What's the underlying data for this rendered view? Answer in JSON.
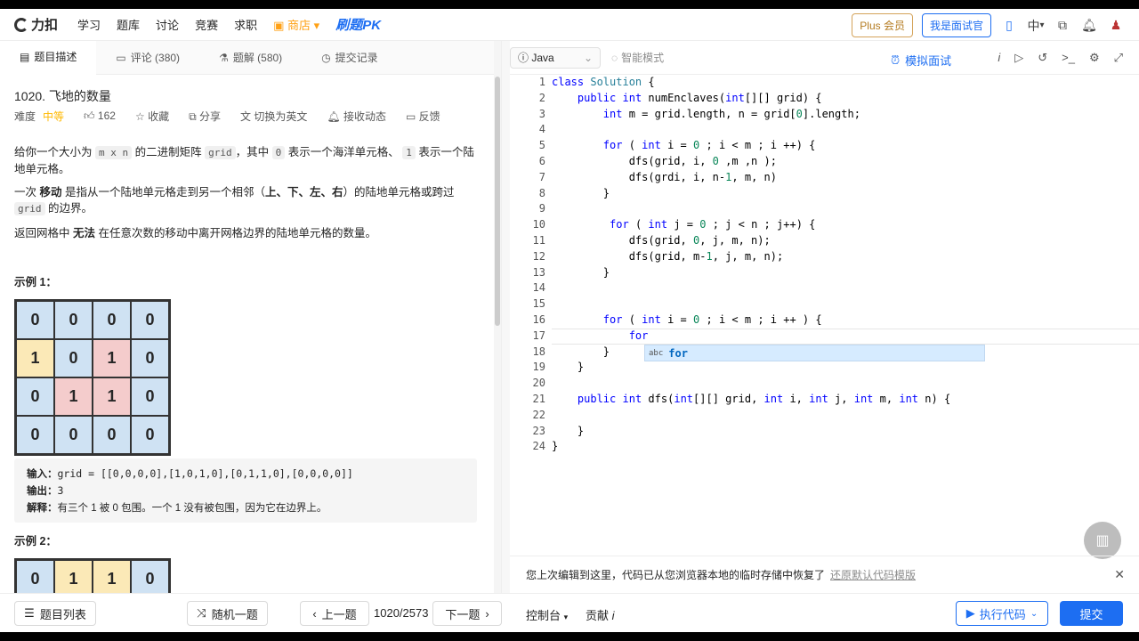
{
  "topbar": {
    "logo_text": "力扣",
    "nav": [
      "学习",
      "题库",
      "讨论",
      "竞赛",
      "求职"
    ],
    "store": "商店",
    "pk": "刷题PK",
    "plus": "Plus 会员",
    "interviewer": "我是面试官",
    "lang": "中"
  },
  "left_tabs": [
    "题目描述",
    "评论 (380)",
    "题解 (580)",
    "提交记录"
  ],
  "problem": {
    "title": "1020. 飞地的数量",
    "difficulty_label": "难度",
    "difficulty": "中等",
    "likes": "162",
    "favorite": "收藏",
    "share": "分享",
    "switch_en": "切换为英文",
    "subscribe": "接收动态",
    "feedback": "反馈",
    "desc1_a": "给你一个大小为",
    "desc1_code1": "m x n",
    "desc1_b": "的二进制矩阵",
    "desc1_code2": "grid",
    "desc1_c": "，其中",
    "desc1_code3": "0",
    "desc1_d": "表示一个海洋单元格、",
    "desc1_code4": "1",
    "desc1_e": "表示一个陆地单元格。",
    "desc2_a": "一次",
    "desc2_bold1": "移动",
    "desc2_b": "是指从一个陆地单元格走到另一个相邻（",
    "desc2_bold2": "上、下、左、右",
    "desc2_c": "）的陆地单元格或跨过",
    "desc2_code": "grid",
    "desc2_d": "的边界。",
    "desc3_a": "返回网格中",
    "desc3_bold": "无法",
    "desc3_b": "在任意次数的移动中离开网格边界的陆地单元格的数量。",
    "example1_title": "示例 1：",
    "example1_grid": [
      [
        "0",
        "0",
        "0",
        "0"
      ],
      [
        "1",
        "0",
        "1",
        "0"
      ],
      [
        "0",
        "1",
        "1",
        "0"
      ],
      [
        "0",
        "0",
        "0",
        "0"
      ]
    ],
    "example1_input_label": "输入：",
    "example1_input": "grid = [[0,0,0,0],[1,0,1,0],[0,1,1,0],[0,0,0,0]]",
    "example1_output_label": "输出：",
    "example1_output": "3",
    "example1_explain_label": "解释：",
    "example1_explain": "有三个 1 被 0 包围。一个 1 没有被包围，因为它在边界上。",
    "example2_title": "示例 2：",
    "example2_grid_row": [
      "0",
      "1",
      "1",
      "0"
    ]
  },
  "editor": {
    "language": "Java",
    "smart_mode": "智能模式",
    "mock_interview": "模拟面试",
    "line_numbers": [
      "1",
      "2",
      "3",
      "4",
      "5",
      "6",
      "7",
      "8",
      "9",
      "10",
      "11",
      "12",
      "13",
      "14",
      "15",
      "16",
      "17",
      "18",
      "19",
      "20",
      "21",
      "22",
      "23",
      "24"
    ],
    "code_lines": [
      "class Solution {",
      "    public int numEnclaves(int[][] grid) {",
      "        int m = grid.length, n = grid[0].length;",
      "",
      "        for ( int i = 0 ; i < m ; i ++) {",
      "            dfs(grid, i, 0 ,m ,n );",
      "            dfs(grdi, i, n-1, m, n)",
      "        }",
      "",
      "         for ( int j = 0 ; j < n ; j++) {",
      "            dfs(grid, 0, j, m, n);",
      "            dfs(grid, m-1, j, m, n);",
      "        }",
      "",
      "",
      "        for ( int i = 0 ; i < m ; i ++ ) {",
      "            for",
      "        }",
      "    }",
      "",
      "    public int dfs(int[][] grid, int i, int j, int m, int n) {",
      "",
      "    }",
      "}"
    ],
    "suggest_kind": "abc",
    "suggest_word": "for",
    "notice": "您上次编辑到这里，代码已从您浏览器本地的临时存储中恢复了",
    "restore_link": "还原默认代码模版"
  },
  "bottom": {
    "problem_list": "题目列表",
    "random": "随机一题",
    "prev": "上一题",
    "page": "1020/2573",
    "next": "下一题",
    "console": "控制台",
    "contribute": "贡献",
    "run": "执行代码",
    "submit": "提交"
  }
}
